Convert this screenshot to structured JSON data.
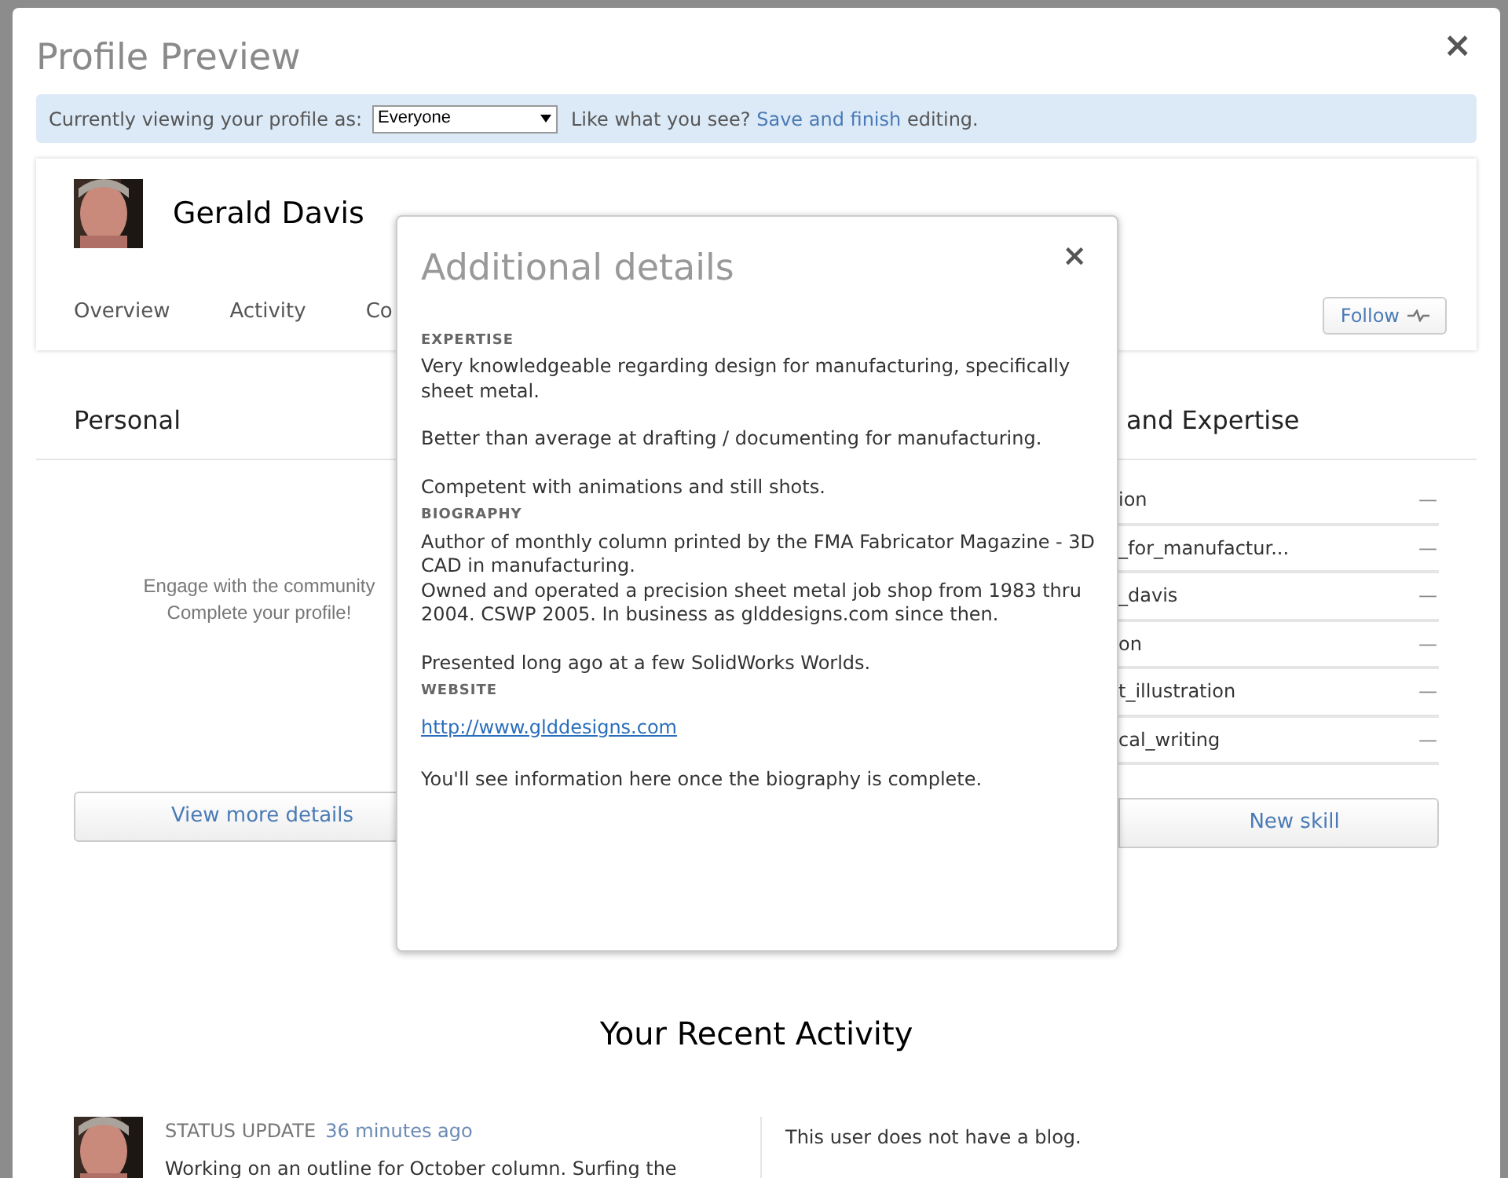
{
  "dialog": {
    "title": "Profile Preview",
    "close": "×"
  },
  "viewing_bar": {
    "label": "Currently viewing your profile as:",
    "select_value": "Everyone",
    "prompt": "Like what you see?",
    "link": "Save and finish",
    "suffix": "editing."
  },
  "profile": {
    "name": "Gerald Davis",
    "follow_button": "Follow"
  },
  "tabs": [
    {
      "label": "Overview",
      "selected": false
    },
    {
      "label": "Activity",
      "selected": false
    },
    {
      "label": "Co",
      "selected": false
    }
  ],
  "personal": {
    "heading": "Personal",
    "messages": [
      "Engage with the community",
      "Complete your profile!"
    ],
    "button": "View more details"
  },
  "skills": {
    "heading": "and Expertise",
    "items": [
      {
        "label": "ion",
        "action": "—"
      },
      {
        "label": "_for_manufactur...",
        "action": "—"
      },
      {
        "label": "_davis",
        "action": "—"
      },
      {
        "label": "on",
        "action": "—"
      },
      {
        "label": "t_illustration",
        "action": "—"
      },
      {
        "label": "cal_writing",
        "action": "—"
      }
    ],
    "button": "New skill"
  },
  "additional_details": {
    "title": "Additional details",
    "close": "×",
    "sections": [
      {
        "heading": "EXPERTISE",
        "paragraphs": [
          "Very knowledgeable regarding design for manufacturing, specifically sheet metal.",
          "Better than average at drafting / documenting for manufacturing.",
          "Competent with animations and still shots."
        ]
      },
      {
        "heading": "BIOGRAPHY",
        "paragraphs": [
          "Author of monthly column printed by the FMA Fabricator Magazine - 3D CAD in manufacturing.\nOwned and operated a precision sheet metal job shop from 1983 thru 2004. CSWP 2005. In business as glddesigns.com since then.",
          "Presented long ago at a few SolidWorks Worlds."
        ]
      },
      {
        "heading": "WEBSITE",
        "link": "http://www.glddesigns.com"
      }
    ],
    "footer": "You'll see information here once the biography is complete."
  },
  "recent_activity": {
    "heading": "Your Recent Activity",
    "items": [
      {
        "type": "STATUS UPDATE",
        "time": "36 minutes ago",
        "text": "Working on an outline for October column. Surfing the"
      }
    ],
    "blog_message": "This user does not have a blog."
  }
}
